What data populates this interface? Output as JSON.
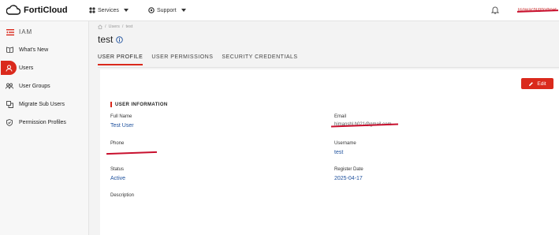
{
  "header": {
    "brand": "FortiCloud",
    "services_label": "Services",
    "support_label": "Support",
    "user_label": "lisnwachl@fortinet"
  },
  "sidebar": {
    "section_title": "IAM",
    "items": [
      {
        "label": "What's New"
      },
      {
        "label": "Users"
      },
      {
        "label": "User Groups"
      },
      {
        "label": "Migrate Sub Users"
      },
      {
        "label": "Permission Profiles"
      }
    ]
  },
  "breadcrumb": {
    "items": [
      "Users",
      "test"
    ]
  },
  "page": {
    "title": "test"
  },
  "tabs": [
    "USER PROFILE",
    "USER PERMISSIONS",
    "SECURITY CREDENTIALS"
  ],
  "actions": {
    "edit_label": "Edit"
  },
  "profile": {
    "section_title": "USER INFORMATION",
    "full_name_label": "Full Name",
    "full_name": "Test User",
    "email_label": "Email",
    "email": "himanshl.h021@gmail.com",
    "phone_label": "Phone",
    "phone": "",
    "username_label": "Username",
    "username": "test",
    "status_label": "Status",
    "status": "Active",
    "register_date_label": "Register Date",
    "register_date": "2025-04-17",
    "description_label": "Description"
  },
  "colors": {
    "accent": "#da291c",
    "link": "#1c4f9c"
  }
}
